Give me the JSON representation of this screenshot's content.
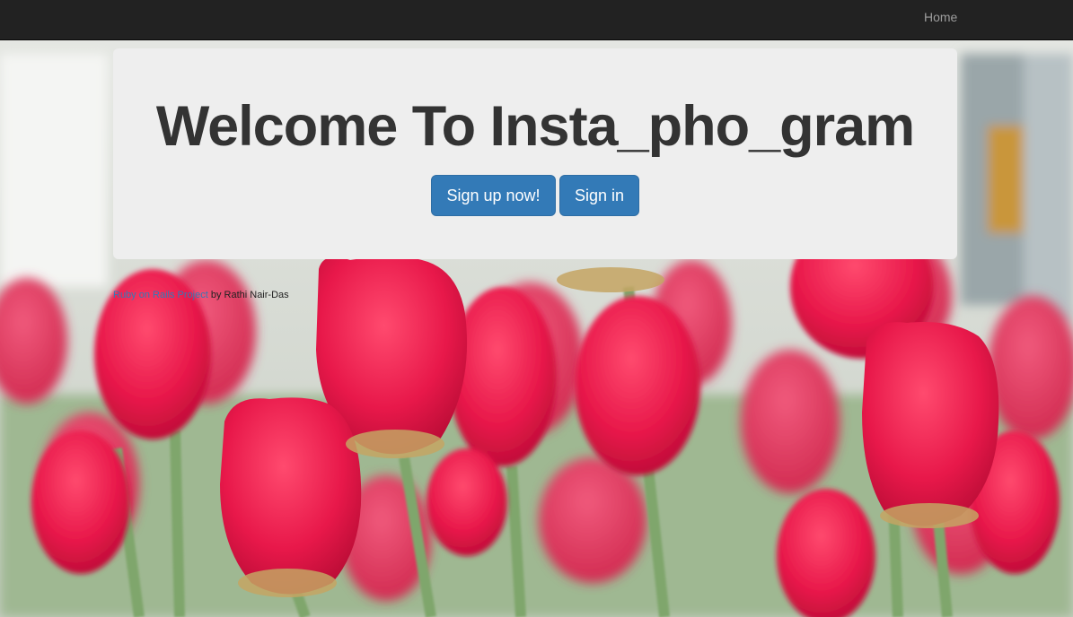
{
  "navbar": {
    "home_label": "Home"
  },
  "jumbotron": {
    "title": "Welcome To Insta_pho_gram",
    "signup_label": "Sign up now!",
    "signin_label": "Sign in"
  },
  "footer": {
    "link_text": "Ruby on Rails Project",
    "by_text": " by Rathi Nair-Das"
  },
  "colors": {
    "navbar_bg": "#222222",
    "jumbotron_bg": "#eeeeee",
    "button_primary": "#337ab7",
    "tulip_red": "#e8234a"
  }
}
